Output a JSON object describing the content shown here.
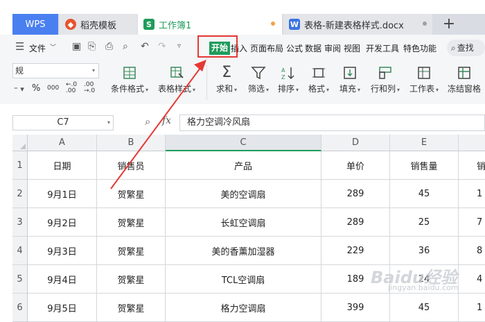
{
  "tabs": {
    "wps": "WPS",
    "daoke": "稻壳模板",
    "workbook": "工作簿1",
    "doc": "表格-新建表格样式.docx",
    "plus": "+"
  },
  "menu": {
    "file": "文件",
    "start": "开始",
    "insert": "插入",
    "layout": "页面布局",
    "formula": "公式",
    "data": "数据",
    "review": "审阅",
    "view": "视图",
    "dev": "开发工具",
    "special": "特色功能",
    "find": "查找"
  },
  "ribbon": {
    "number_format": "规",
    "percent": "%",
    "thousands": "000",
    "cond_format": "条件格式",
    "table_style": "表格样式",
    "sum": "求和",
    "filter": "筛选",
    "sort": "排序",
    "format": "格式",
    "fill": "填充",
    "row_col": "行和列",
    "worksheet": "工作表",
    "freeze": "冻结窗格"
  },
  "formula_bar": {
    "cell_ref": "C7",
    "fx": "fx",
    "content": "格力空调冷风扇"
  },
  "columns": [
    "A",
    "B",
    "C",
    "D",
    "E"
  ],
  "rows": [
    {
      "num": "1",
      "cells": [
        "日期",
        "销售员",
        "产品",
        "单价",
        "销售量",
        "销"
      ]
    },
    {
      "num": "2",
      "cells": [
        "9月1日",
        "贺繁星",
        "美的空调扇",
        "289",
        "45",
        "1"
      ]
    },
    {
      "num": "3",
      "cells": [
        "9月2日",
        "贺繁星",
        "长虹空调扇",
        "289",
        "25",
        "7"
      ]
    },
    {
      "num": "4",
      "cells": [
        "9月3日",
        "贺繁星",
        "美的香薰加湿器",
        "229",
        "36",
        "8"
      ]
    },
    {
      "num": "5",
      "cells": [
        "9月4日",
        "贺繁星",
        "TCL空调扇",
        "189",
        "24",
        "4"
      ]
    },
    {
      "num": "6",
      "cells": [
        "9月5日",
        "贺繁星",
        "格力空调扇",
        "399",
        "45",
        "1"
      ]
    }
  ],
  "watermark": "Baidu经验",
  "watermark_sub": "jingyan.baidu.com",
  "colors": {
    "accent": "#1f9c5c",
    "wps_blue": "#4a7ff0",
    "highlight": "#e53935"
  }
}
